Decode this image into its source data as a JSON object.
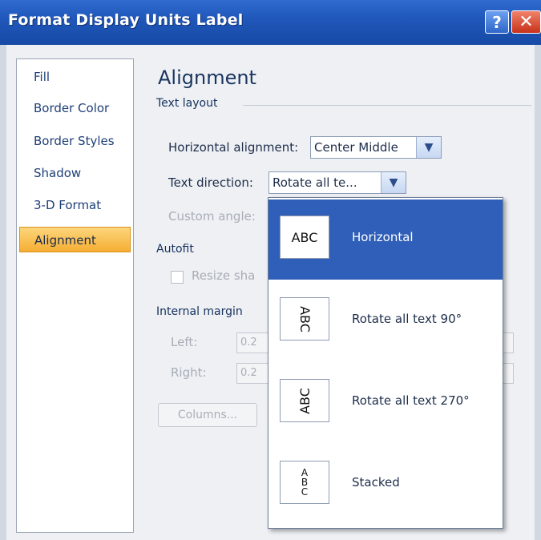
{
  "window": {
    "title": "Format Display Units Label",
    "help_symbol": "?",
    "close_symbol": "✕"
  },
  "nav": {
    "items": [
      {
        "label": "Fill"
      },
      {
        "label": "Border Color"
      },
      {
        "label": "Border Styles"
      },
      {
        "label": "Shadow"
      },
      {
        "label": "3-D Format"
      },
      {
        "label": "Alignment",
        "selected": true
      }
    ]
  },
  "alignment": {
    "heading": "Alignment",
    "text_layout": {
      "group_label": "Text layout",
      "horizontal_alignment_label": "Horizontal alignment:",
      "horizontal_alignment_value": "Center Middle",
      "text_direction_label": "Text direction:",
      "text_direction_value": "Rotate all te...",
      "custom_angle_label": "Custom angle:"
    },
    "autofit": {
      "group_label": "Autofit",
      "resize_label": "Resize sha"
    },
    "internal_margin": {
      "group_label": "Internal margin",
      "left_label": "Left:",
      "left_value": "0.2",
      "right_label": "Right:",
      "right_value": "0.2"
    },
    "columns_button": "Columns..."
  },
  "text_direction_dropdown": {
    "options": [
      {
        "icon_text": "ABC",
        "label": "Horizontal",
        "selected": true
      },
      {
        "icon_text": "ABC",
        "label": "Rotate all text 90°"
      },
      {
        "icon_text": "ABC",
        "label": "Rotate all text 270°"
      },
      {
        "icon_text": "A\nB\nC",
        "label": "Stacked"
      }
    ]
  },
  "colors": {
    "title_bar": "#1f56b8",
    "selected_option": "#2f5fb8",
    "selected_nav": "#f6ae33"
  }
}
